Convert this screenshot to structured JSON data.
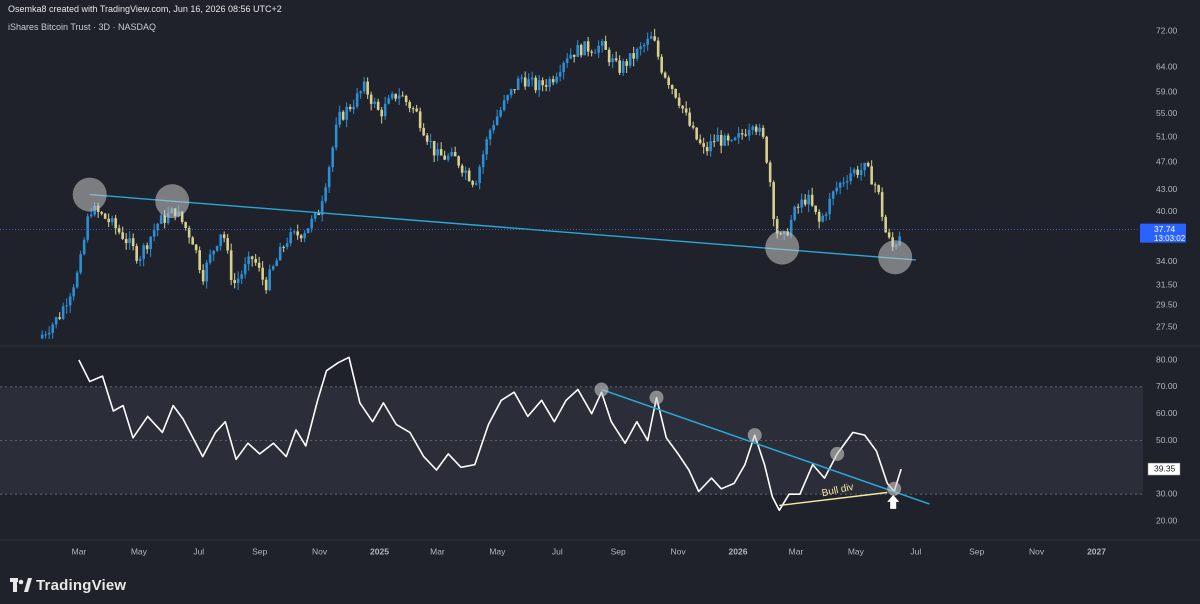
{
  "header": {
    "attribution": "Osemka8 created with TradingView.com, Jun 16, 2026 08:56 UTC+2",
    "symbol": "iShares Bitcoin Trust · 3D · NASDAQ"
  },
  "brand": {
    "name": "TradingView",
    "icon": "tradingview-logo-icon"
  },
  "colors": {
    "background": "#1f222b",
    "up_candle": "#2c8fd6",
    "down_candle": "#d8cf8f",
    "trendline": "#2aa7d8",
    "rsi_line": "#ffffff",
    "rsi_band": "#2b2e38",
    "marker": "#c8c8c8",
    "annotation": "#f3e9a1",
    "price_tag": "#2962ff"
  },
  "chart_data": [
    {
      "type": "candlestick",
      "title": "iShares Bitcoin Trust · 3D · NASDAQ",
      "x_ticks": [
        "Mar",
        "May",
        "Jul",
        "Sep",
        "Nov",
        "2025",
        "Mar",
        "May",
        "Jul",
        "Sep",
        "Nov",
        "2026",
        "Mar",
        "May",
        "Jul",
        "Sep",
        "Nov",
        "2027"
      ],
      "y_ticks": [
        72.0,
        64.0,
        59.0,
        55.0,
        51.0,
        47.0,
        43.0,
        40.0,
        34.0,
        31.5,
        29.5,
        27.5
      ],
      "y_scale": "log",
      "ylim": [
        25.5,
        75
      ],
      "last_price": {
        "value": "37.74",
        "countdown": "13:03:02"
      },
      "price_path": [
        {
          "t": "2024-01-20",
          "p": 26.5
        },
        {
          "t": "2024-02-10",
          "p": 28.5
        },
        {
          "t": "2024-03-01",
          "p": 33
        },
        {
          "t": "2024-03-12",
          "p": 40.5
        },
        {
          "t": "2024-03-30",
          "p": 39
        },
        {
          "t": "2024-04-15",
          "p": 37
        },
        {
          "t": "2024-05-01",
          "p": 34.5
        },
        {
          "t": "2024-05-20",
          "p": 38.5
        },
        {
          "t": "2024-06-07",
          "p": 40.2
        },
        {
          "t": "2024-06-25",
          "p": 36.5
        },
        {
          "t": "2024-07-05",
          "p": 32.5
        },
        {
          "t": "2024-07-25",
          "p": 38
        },
        {
          "t": "2024-08-05",
          "p": 31.5
        },
        {
          "t": "2024-08-25",
          "p": 34.5
        },
        {
          "t": "2024-09-07",
          "p": 31.5
        },
        {
          "t": "2024-09-28",
          "p": 36.5
        },
        {
          "t": "2024-10-15",
          "p": 37.5
        },
        {
          "t": "2024-10-30",
          "p": 39.5
        },
        {
          "t": "2024-11-10",
          "p": 46
        },
        {
          "t": "2024-11-20",
          "p": 54
        },
        {
          "t": "2024-12-05",
          "p": 57
        },
        {
          "t": "2024-12-17",
          "p": 60
        },
        {
          "t": "2025-01-01",
          "p": 55
        },
        {
          "t": "2025-01-20",
          "p": 59
        },
        {
          "t": "2025-02-08",
          "p": 55
        },
        {
          "t": "2025-02-28",
          "p": 48
        },
        {
          "t": "2025-03-20",
          "p": 47.5
        },
        {
          "t": "2025-04-08",
          "p": 44
        },
        {
          "t": "2025-04-25",
          "p": 53
        },
        {
          "t": "2025-05-12",
          "p": 58
        },
        {
          "t": "2025-05-25",
          "p": 62
        },
        {
          "t": "2025-06-10",
          "p": 60
        },
        {
          "t": "2025-06-25",
          "p": 61.5
        },
        {
          "t": "2025-07-10",
          "p": 66.5
        },
        {
          "t": "2025-07-25",
          "p": 68
        },
        {
          "t": "2025-08-15",
          "p": 68.5
        },
        {
          "t": "2025-09-01",
          "p": 63.5
        },
        {
          "t": "2025-09-15",
          "p": 66
        },
        {
          "t": "2025-10-06",
          "p": 70.5
        },
        {
          "t": "2025-10-15",
          "p": 64
        },
        {
          "t": "2025-11-01",
          "p": 58
        },
        {
          "t": "2025-11-15",
          "p": 52
        },
        {
          "t": "2025-11-28",
          "p": 48.5
        },
        {
          "t": "2025-12-10",
          "p": 51
        },
        {
          "t": "2025-12-25",
          "p": 49.5
        },
        {
          "t": "2026-01-08",
          "p": 52
        },
        {
          "t": "2026-01-16",
          "p": 54
        },
        {
          "t": "2026-01-28",
          "p": 50
        },
        {
          "t": "2026-02-03",
          "p": 44
        },
        {
          "t": "2026-02-08",
          "p": 38
        },
        {
          "t": "2026-02-15",
          "p": 36.2
        },
        {
          "t": "2026-02-28",
          "p": 40
        },
        {
          "t": "2026-03-12",
          "p": 42
        },
        {
          "t": "2026-03-25",
          "p": 38.5
        },
        {
          "t": "2026-04-10",
          "p": 43
        },
        {
          "t": "2026-04-25",
          "p": 45.5
        },
        {
          "t": "2026-05-10",
          "p": 46
        },
        {
          "t": "2026-05-16",
          "p": 45
        },
        {
          "t": "2026-05-23",
          "p": 43
        },
        {
          "t": "2026-06-01",
          "p": 37
        },
        {
          "t": "2026-06-08",
          "p": 35.5
        },
        {
          "t": "2026-06-16",
          "p": 37.74
        }
      ],
      "trendlines": [
        {
          "from": {
            "t": "2024-03-12",
            "p": 42.3
          },
          "to": {
            "t": "2026-07-01",
            "p": 34.2
          }
        }
      ],
      "circle_markers": [
        {
          "t": "2024-03-12",
          "p": 42.3
        },
        {
          "t": "2024-06-04",
          "p": 41.4
        },
        {
          "t": "2026-02-15",
          "p": 35.6
        },
        {
          "t": "2026-06-10",
          "p": 34.5
        }
      ]
    },
    {
      "type": "line",
      "indicator": "oscillator",
      "y_ticks": [
        80.0,
        70.0,
        60.0,
        50.0,
        40.0,
        30.0,
        20.0
      ],
      "ylim": [
        15,
        88
      ],
      "bands": [
        30,
        50,
        70
      ],
      "last_value": "39.35",
      "series": [
        {
          "t": "2024-03-01",
          "v": 80
        },
        {
          "t": "2024-03-12",
          "v": 72
        },
        {
          "t": "2024-03-25",
          "v": 74
        },
        {
          "t": "2024-04-05",
          "v": 61
        },
        {
          "t": "2024-04-15",
          "v": 63
        },
        {
          "t": "2024-04-25",
          "v": 51
        },
        {
          "t": "2024-05-10",
          "v": 59
        },
        {
          "t": "2024-05-25",
          "v": 53
        },
        {
          "t": "2024-06-05",
          "v": 63
        },
        {
          "t": "2024-06-15",
          "v": 58
        },
        {
          "t": "2024-06-25",
          "v": 51
        },
        {
          "t": "2024-07-05",
          "v": 44
        },
        {
          "t": "2024-07-18",
          "v": 53
        },
        {
          "t": "2024-07-28",
          "v": 57
        },
        {
          "t": "2024-08-08",
          "v": 43
        },
        {
          "t": "2024-08-20",
          "v": 49
        },
        {
          "t": "2024-09-01",
          "v": 45
        },
        {
          "t": "2024-09-15",
          "v": 49
        },
        {
          "t": "2024-09-28",
          "v": 44
        },
        {
          "t": "2024-10-08",
          "v": 54
        },
        {
          "t": "2024-10-18",
          "v": 48
        },
        {
          "t": "2024-10-30",
          "v": 65
        },
        {
          "t": "2024-11-08",
          "v": 76
        },
        {
          "t": "2024-11-20",
          "v": 79
        },
        {
          "t": "2024-12-01",
          "v": 81
        },
        {
          "t": "2024-12-12",
          "v": 64
        },
        {
          "t": "2024-12-25",
          "v": 57
        },
        {
          "t": "2025-01-05",
          "v": 64
        },
        {
          "t": "2025-01-18",
          "v": 56
        },
        {
          "t": "2025-02-01",
          "v": 53
        },
        {
          "t": "2025-02-15",
          "v": 44
        },
        {
          "t": "2025-02-28",
          "v": 39
        },
        {
          "t": "2025-03-12",
          "v": 45
        },
        {
          "t": "2025-03-25",
          "v": 40
        },
        {
          "t": "2025-04-08",
          "v": 41
        },
        {
          "t": "2025-04-22",
          "v": 56
        },
        {
          "t": "2025-05-05",
          "v": 65
        },
        {
          "t": "2025-05-18",
          "v": 68
        },
        {
          "t": "2025-06-01",
          "v": 59
        },
        {
          "t": "2025-06-15",
          "v": 65
        },
        {
          "t": "2025-06-28",
          "v": 57
        },
        {
          "t": "2025-07-10",
          "v": 65
        },
        {
          "t": "2025-07-22",
          "v": 69
        },
        {
          "t": "2025-08-05",
          "v": 60
        },
        {
          "t": "2025-08-15",
          "v": 68
        },
        {
          "t": "2025-08-25",
          "v": 57
        },
        {
          "t": "2025-09-08",
          "v": 49
        },
        {
          "t": "2025-09-20",
          "v": 57
        },
        {
          "t": "2025-10-01",
          "v": 50
        },
        {
          "t": "2025-10-10",
          "v": 66
        },
        {
          "t": "2025-10-20",
          "v": 51
        },
        {
          "t": "2025-11-01",
          "v": 45
        },
        {
          "t": "2025-11-12",
          "v": 39
        },
        {
          "t": "2025-11-22",
          "v": 31
        },
        {
          "t": "2025-12-05",
          "v": 36
        },
        {
          "t": "2025-12-15",
          "v": 32
        },
        {
          "t": "2025-12-28",
          "v": 34
        },
        {
          "t": "2026-01-08",
          "v": 41
        },
        {
          "t": "2026-01-18",
          "v": 52
        },
        {
          "t": "2026-01-28",
          "v": 41
        },
        {
          "t": "2026-02-05",
          "v": 29
        },
        {
          "t": "2026-02-12",
          "v": 24
        },
        {
          "t": "2026-02-22",
          "v": 30
        },
        {
          "t": "2026-03-05",
          "v": 30
        },
        {
          "t": "2026-03-18",
          "v": 41
        },
        {
          "t": "2026-03-30",
          "v": 36
        },
        {
          "t": "2026-04-12",
          "v": 45
        },
        {
          "t": "2026-04-28",
          "v": 53
        },
        {
          "t": "2026-05-10",
          "v": 52
        },
        {
          "t": "2026-05-22",
          "v": 46
        },
        {
          "t": "2026-06-02",
          "v": 34
        },
        {
          "t": "2026-06-09",
          "v": 31
        },
        {
          "t": "2026-06-16",
          "v": 39.35
        }
      ],
      "trendlines": [
        {
          "from": {
            "t": "2025-08-15",
            "v": 69
          },
          "to": {
            "t": "2026-07-15",
            "v": 26.3
          }
        },
        {
          "from": {
            "t": "2026-02-12",
            "v": 25.8
          },
          "to": {
            "t": "2026-06-02",
            "v": 30.6
          }
        }
      ],
      "circle_markers": [
        {
          "t": "2025-08-15",
          "v": 69
        },
        {
          "t": "2025-10-10",
          "v": 66
        },
        {
          "t": "2026-01-18",
          "v": 52
        },
        {
          "t": "2026-04-12",
          "v": 45
        },
        {
          "t": "2026-06-09",
          "v": 32
        }
      ],
      "annotations": [
        {
          "text": "Bull div",
          "t": "2026-03-28",
          "v": 29.2
        },
        {
          "text": "up-arrow",
          "t": "2026-06-08",
          "v": 26
        }
      ]
    }
  ]
}
